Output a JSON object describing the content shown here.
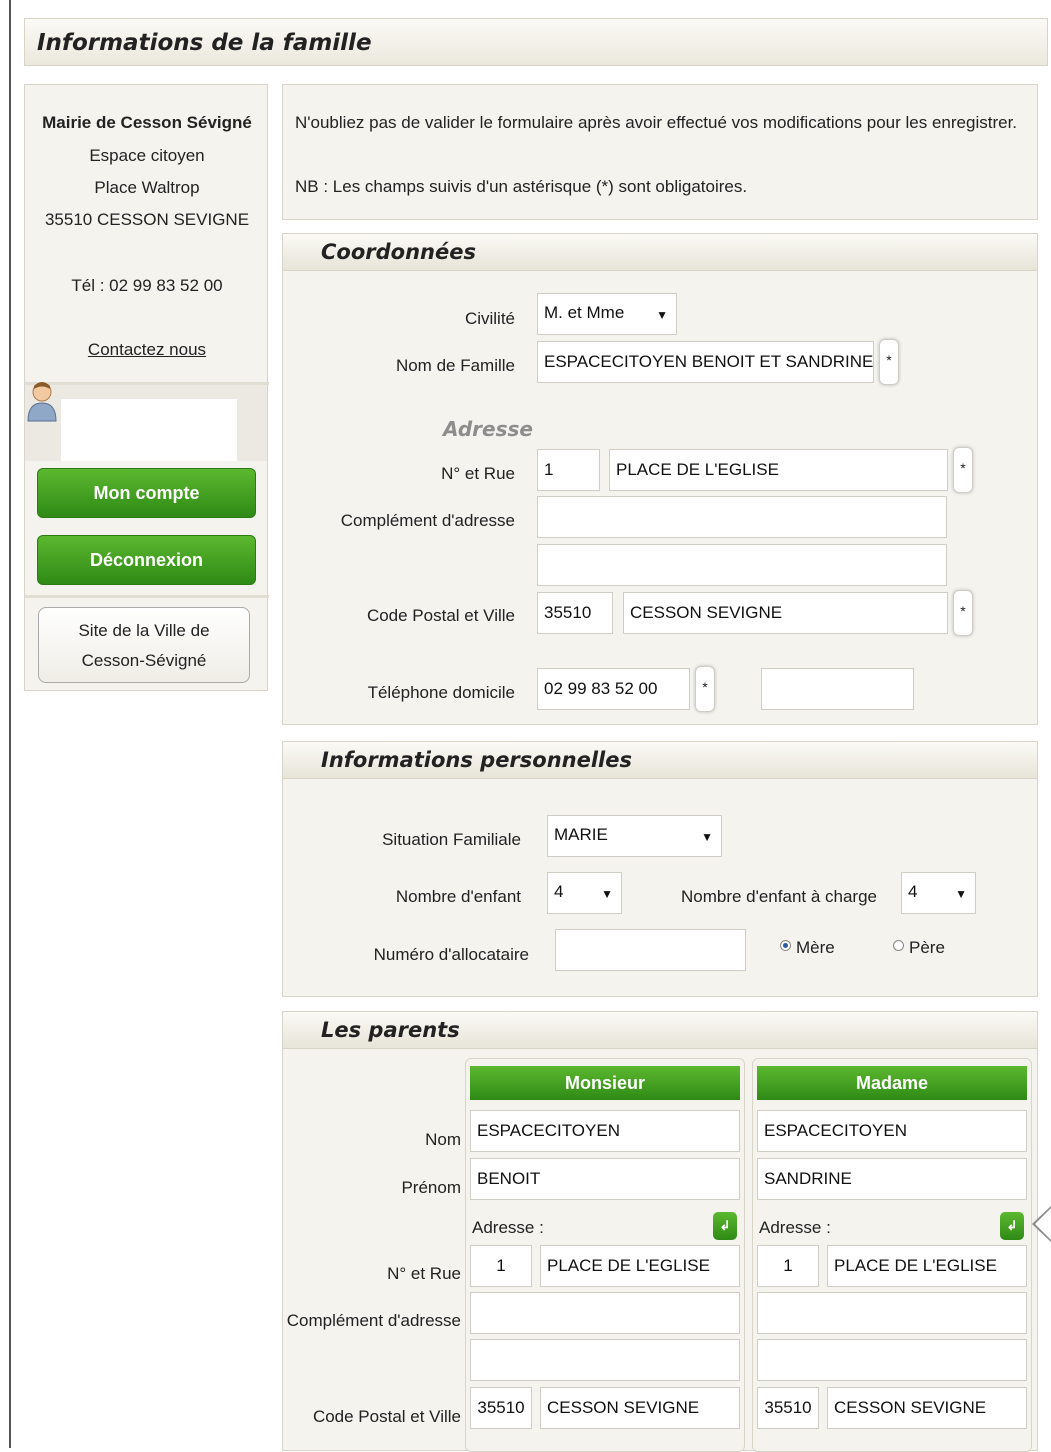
{
  "page_title": "Informations de la famille",
  "sidebar": {
    "org_name": "Mairie de Cesson Sévigné",
    "address_line1": "Espace citoyen",
    "address_line2": "Place Waltrop",
    "address_line3": "35510 CESSON SEVIGNE",
    "phone": "Tél : 02 99 83 52 00",
    "contact_link": "Contactez nous",
    "account_button": "Mon compte",
    "logout_button": "Déconnexion",
    "site_button_line1": "Site de la Ville de",
    "site_button_line2": "Cesson-Sévigné"
  },
  "notice": {
    "line1": "N'oubliez pas de valider le formulaire après avoir effectué vos modifications pour les enregistrer.",
    "line2": "NB : Les champs suivis d'un  astérisque (*) sont obligatoires."
  },
  "coordonnees": {
    "title": "Coordonnées",
    "civilite_label": "Civilité",
    "civilite_value": "M. et Mme",
    "nom_famille_label": "Nom de Famille",
    "nom_famille_value": "ESPACECITOYEN BENOIT ET SANDRINE",
    "adresse_heading": "Adresse",
    "rue_label": "N° et Rue",
    "rue_num": "1",
    "rue_value": "PLACE DE L'EGLISE",
    "complement_label": "Complément d'adresse",
    "complement1": "",
    "complement2": "",
    "cp_label": "Code Postal et Ville",
    "cp_value": "35510",
    "ville_value": "CESSON SEVIGNE",
    "tel_label": "Téléphone domicile",
    "tel_value": "02 99 83 52 00",
    "tel2_value": "",
    "required_mark": "*"
  },
  "perso": {
    "title": "Informations personnelles",
    "situation_label": "Situation Familiale",
    "situation_value": "MARIE",
    "nb_enfant_label": "Nombre d'enfant",
    "nb_enfant_value": "4",
    "nb_charge_label": "Nombre d'enfant à charge",
    "nb_charge_value": "4",
    "allocataire_label": "Numéro d'allocataire",
    "allocataire_value": "",
    "radio_mere": "Mère",
    "radio_pere": "Père",
    "selected_radio": "Mère"
  },
  "parents": {
    "title": "Les parents",
    "row_labels": {
      "nom": "Nom",
      "prenom": "Prénom",
      "rue": "N° et Rue",
      "complement": "Complément d'adresse",
      "cp": "Code Postal et Ville"
    },
    "adresse_label": "Adresse :",
    "copy_icon_glyph": "↲",
    "monsieur": {
      "header": "Monsieur",
      "nom": "ESPACECITOYEN",
      "prenom": "BENOIT",
      "rue_num": "1",
      "rue": "PLACE DE L'EGLISE",
      "complement1": "",
      "complement2": "",
      "cp": "35510",
      "ville": "CESSON SEVIGNE"
    },
    "madame": {
      "header": "Madame",
      "nom": "ESPACECITOYEN",
      "prenom": "SANDRINE",
      "rue_num": "1",
      "rue": "PLACE DE L'EGLISE",
      "complement1": "",
      "complement2": "",
      "cp": "35510",
      "ville": "CESSON SEVIGNE"
    }
  },
  "colors": {
    "accent_green": "#3f9e1f",
    "panel_bg": "#f4f3ee"
  }
}
